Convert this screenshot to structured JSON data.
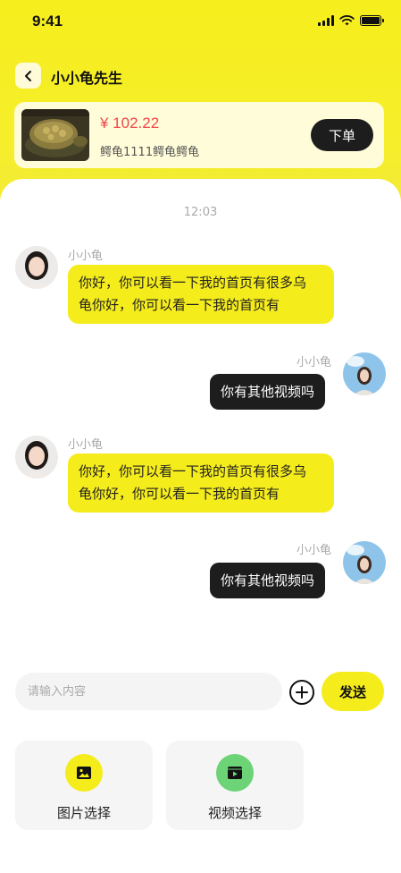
{
  "status_bar": {
    "time": "9:41"
  },
  "header": {
    "title": "小小龟先生",
    "back_icon": "chevron-left-icon"
  },
  "product": {
    "price": "¥ 102.22",
    "name": "鳄龟1111鳄龟鳄龟",
    "order_label": "下单"
  },
  "chat": {
    "time": "12:03",
    "messages": [
      {
        "side": "left",
        "sender": "小小龟",
        "text_line1": "你好，你可以看一下我的首页有很多乌",
        "text_line2": "龟你好，你可以看一下我的首页有"
      },
      {
        "side": "right",
        "sender": "小小龟",
        "text": "你有其他视频吗"
      },
      {
        "side": "left",
        "sender": "小小龟",
        "text_line1": "你好，你可以看一下我的首页有很多乌",
        "text_line2": "龟你好，你可以看一下我的首页有"
      },
      {
        "side": "right",
        "sender": "小小龟",
        "text": "你有其他视频吗"
      }
    ]
  },
  "composer": {
    "placeholder": "请输入内容",
    "send_label": "发送",
    "plus_icon": "plus-circle-icon"
  },
  "tools": [
    {
      "label": "图片选择",
      "icon": "image-icon",
      "color": "#f5ec1c"
    },
    {
      "label": "视频选择",
      "icon": "video-icon",
      "color": "#6cd377"
    }
  ],
  "colors": {
    "accent_yellow": "#f5ec1c",
    "dark_bubble": "#1d1d1d",
    "price_red": "#f0454a",
    "video_green": "#6cd377"
  }
}
